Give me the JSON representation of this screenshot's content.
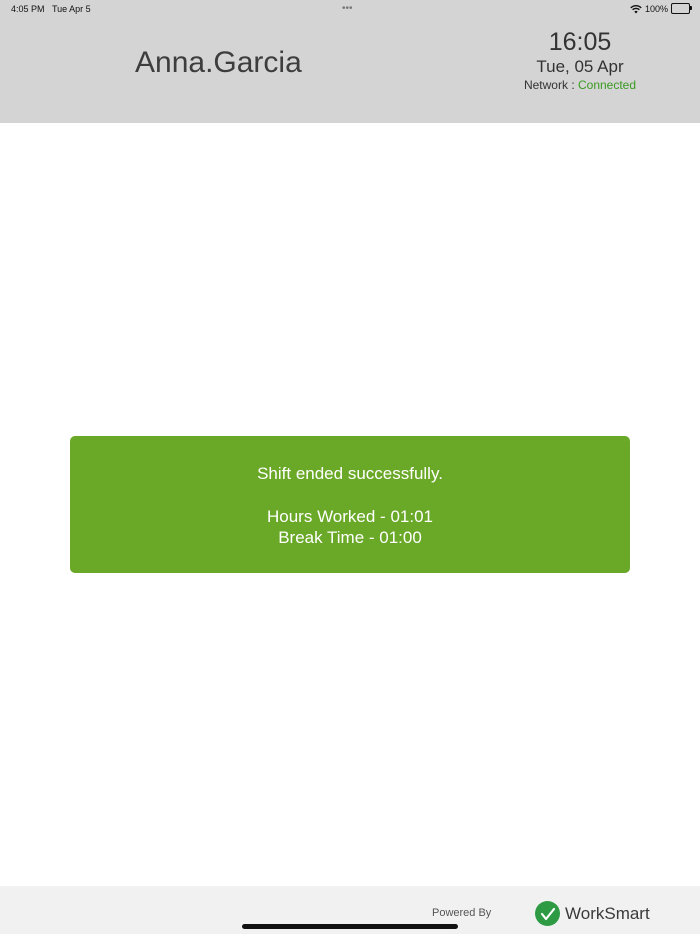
{
  "status_bar": {
    "time": "4:05 PM",
    "date": "Tue Apr 5",
    "battery": "100%",
    "dots": "•••"
  },
  "header": {
    "user_name": "Anna.Garcia",
    "clock_time": "16:05",
    "clock_date": "Tue, 05 Apr",
    "network_label": "Network : ",
    "network_status": "Connected",
    "network_status_color": "#3a9a23",
    "background_color": "#d4d4d4"
  },
  "toast": {
    "message": "Shift ended successfully.",
    "hours_worked": "Hours Worked - 01:01",
    "break_time": "Break Time - 01:00",
    "background_color": "#6aa828"
  },
  "footer": {
    "powered_by": "Powered By",
    "brand_name": "WorkSmart",
    "brand_icon": "checkmark-logo-icon"
  }
}
